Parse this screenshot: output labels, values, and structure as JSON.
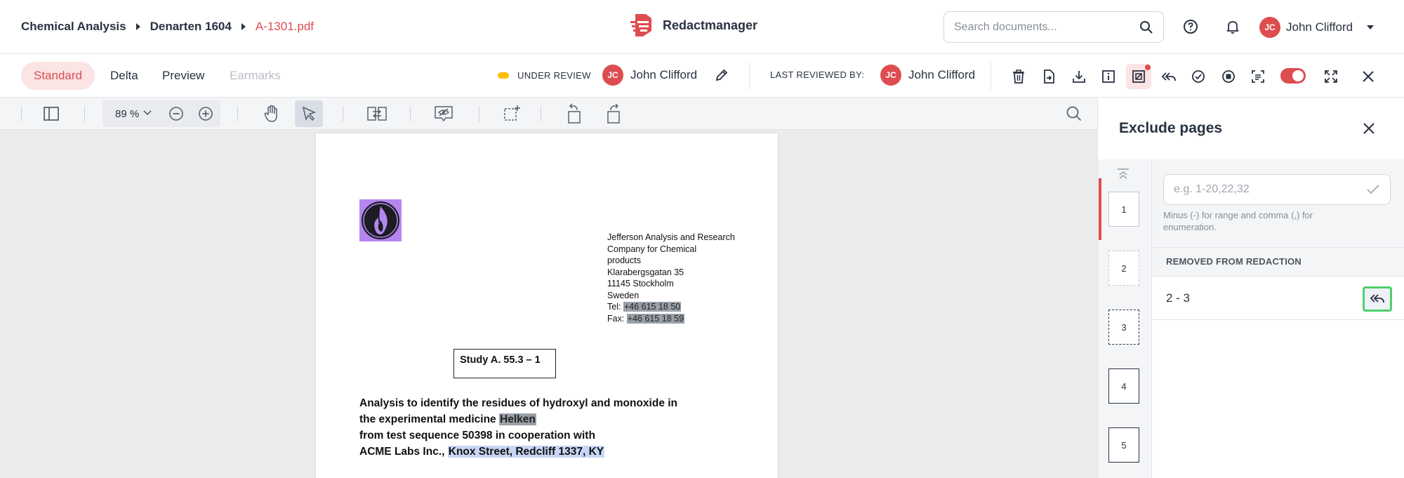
{
  "breadcrumb": {
    "items": [
      "Chemical Analysis",
      "Denarten 1604"
    ],
    "current": "A-1301.pdf"
  },
  "brand": {
    "name": "Redactmanager",
    "logo_icon": "redactmanager-logo-icon"
  },
  "search": {
    "placeholder": "Search documents..."
  },
  "user": {
    "initials": "JC",
    "name": "John Clifford"
  },
  "tabs": [
    {
      "label": "Standard",
      "state": "active"
    },
    {
      "label": "Delta",
      "state": "normal"
    },
    {
      "label": "Preview",
      "state": "normal"
    },
    {
      "label": "Earmarks",
      "state": "disabled"
    }
  ],
  "status": {
    "label": "UNDER REVIEW",
    "color": "#fdbd00"
  },
  "assignee": {
    "initials": "JC",
    "name": "John Clifford"
  },
  "last_reviewed": {
    "label": "LAST REVIEWED BY:",
    "initials": "JC",
    "name": "John Clifford"
  },
  "viewer": {
    "zoom": "89 %"
  },
  "document": {
    "address": [
      "Jefferson Analysis and Research",
      "Company for Chemical",
      "products",
      "Klarabergsgatan 35",
      "11145 Stockholm",
      "Sweden"
    ],
    "tel_label": "Tel:",
    "tel_value": "+46 615 18 50",
    "fax_label": "Fax:",
    "fax_value": "+46 615 18 59",
    "study": "Study A. 55.3 – 1",
    "analysis_line1": "Analysis to identify the residues of hydroxyl and monoxide in",
    "analysis_line2_pre": "the experimental medicine ",
    "analysis_line2_hl": "Helken",
    "analysis_line3": "from test sequence 50398 in cooperation with",
    "analysis_line4_pre": "ACME Labs Inc., ",
    "analysis_line4_hl": "Knox Street, Redcliff 1337, KY"
  },
  "panel": {
    "title": "Exclude pages",
    "input_placeholder": "e.g. 1-20,22,32",
    "hint": "Minus (-) for range and comma (,) for enumeration.",
    "removed_heading": "REMOVED FROM REDACTION",
    "removed_ranges": [
      "2 - 3"
    ]
  },
  "thumbnails": [
    "1",
    "2",
    "3",
    "4",
    "5"
  ],
  "colors": {
    "accent": "#dd4d50",
    "highlight_green": "#4fcf6e"
  }
}
